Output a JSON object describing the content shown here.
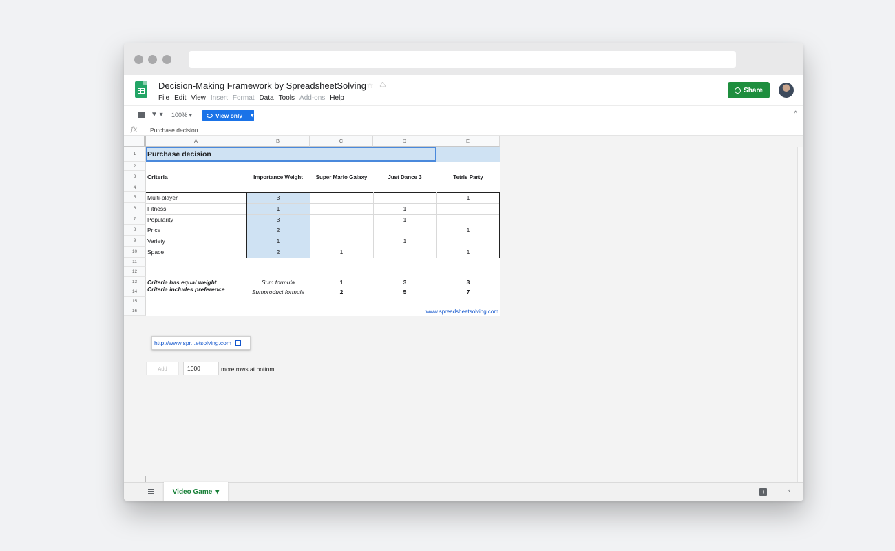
{
  "document": {
    "title": "Decision-Making Framework by SpreadsheetSolving",
    "menus": [
      {
        "label": "File",
        "dim": false
      },
      {
        "label": "Edit",
        "dim": false
      },
      {
        "label": "View",
        "dim": false
      },
      {
        "label": "Insert",
        "dim": true
      },
      {
        "label": "Format",
        "dim": true
      },
      {
        "label": "Data",
        "dim": false
      },
      {
        "label": "Tools",
        "dim": false
      },
      {
        "label": "Add-ons",
        "dim": true
      },
      {
        "label": "Help",
        "dim": false
      }
    ],
    "share_label": "Share"
  },
  "toolbar": {
    "filter_glyph": "▼ ▾",
    "zoom": "100%",
    "zoom_caret": "▾",
    "view_only_label": "View only",
    "view_only_caret": "▾",
    "collapse_glyph": "^"
  },
  "formula_bar": {
    "fx": "fx",
    "content": "Purchase decision"
  },
  "columns": [
    "A",
    "B",
    "C",
    "D",
    "E"
  ],
  "rows": [
    "1",
    "2",
    "3",
    "4",
    "5",
    "6",
    "7",
    "8",
    "9",
    "10",
    "11",
    "12",
    "13",
    "14",
    "15",
    "16"
  ],
  "cells": {
    "title": "Purchase decision",
    "headers": {
      "criteria": "Criteria",
      "importance": "Importance Weight",
      "game1": "Super Mario Galaxy",
      "game2": "Just Dance 3",
      "game3": "Tetris Party"
    },
    "criteria_rows": [
      {
        "name": "Multi-player",
        "weight": "3",
        "g1": "",
        "g2": "",
        "g3": "1"
      },
      {
        "name": "Fitness",
        "weight": "1",
        "g1": "",
        "g2": "1",
        "g3": ""
      },
      {
        "name": "Popularity",
        "weight": "3",
        "g1": "",
        "g2": "1",
        "g3": ""
      },
      {
        "name": "Price",
        "weight": "2",
        "g1": "",
        "g2": "",
        "g3": "1"
      },
      {
        "name": "Variety",
        "weight": "1",
        "g1": "",
        "g2": "1",
        "g3": ""
      },
      {
        "name": "Space",
        "weight": "2",
        "g1": "1",
        "g2": "",
        "g3": "1"
      }
    ],
    "summary": [
      {
        "label": "Criteria has equal weight",
        "formula": "Sum formula",
        "g1": "1",
        "g2": "3",
        "g3": "3"
      },
      {
        "label": "Criteria includes preference",
        "formula": "Sumproduct formula",
        "g1": "2",
        "g2": "5",
        "g3": "7"
      }
    ],
    "website": "www.spreadsheetsolving.com"
  },
  "link_tooltip": {
    "url": "http://www.spr...etsolving.com"
  },
  "add_rows": {
    "button_label": "Add",
    "count": "1000",
    "suffix": "more rows at bottom."
  },
  "tabs": {
    "active": "Video Game",
    "caret": "▾",
    "sidebar_glyph": "‹"
  },
  "colors": {
    "sheets_green": "#23a566",
    "share_green": "#1e8e3e",
    "view_only_blue": "#1a73e8",
    "selection_blue": "#cfe2f3",
    "link_blue": "#1155cc"
  }
}
